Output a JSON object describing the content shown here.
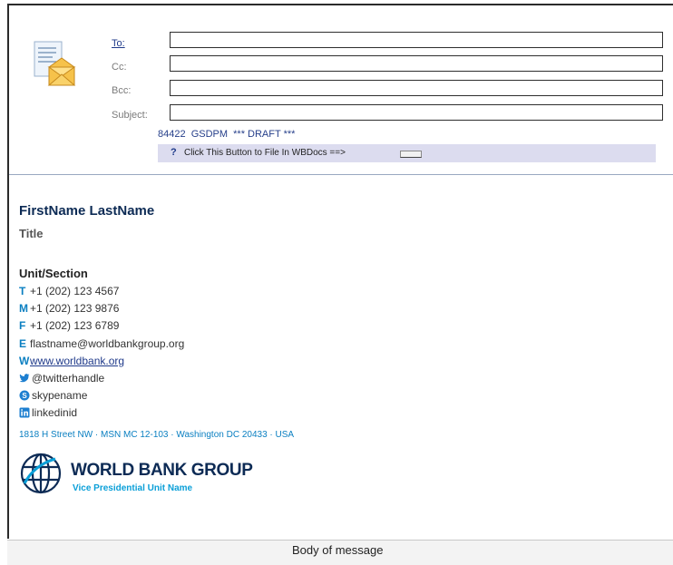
{
  "header": {
    "fields": [
      {
        "label": "To:",
        "value": ""
      },
      {
        "label": "Cc:",
        "value": ""
      },
      {
        "label": "Bcc:",
        "value": ""
      },
      {
        "label": "Subject:",
        "value": ""
      }
    ],
    "tag_line": "84422  GSDPM  *** DRAFT ***",
    "file_button": {
      "icon": "?",
      "text": "Click This Button to File In WBDocs ==>"
    }
  },
  "signature": {
    "name": "FirstName LastName",
    "title": "Title",
    "unit": "Unit/Section",
    "contacts": [
      {
        "key": "T",
        "text": "+1 (202) 123 4567"
      },
      {
        "key": "M",
        "text": "+1 (202) 123 9876"
      },
      {
        "key": "F",
        "text": "+1 (202) 123 6789"
      },
      {
        "key": "E",
        "text": "flastname@worldbankgroup.org"
      },
      {
        "key": "W",
        "text": "www.worldbank.org"
      },
      {
        "icon": "twitter-icon",
        "text": "@twitterhandle"
      },
      {
        "icon": "skype-icon",
        "text": "skypename"
      },
      {
        "icon": "linkedin-icon",
        "text": "linkedinid"
      }
    ],
    "address": "1818 H Street NW · MSN MC 12-103 · Washington DC 20433 · USA",
    "org_name": "WORLD BANK GROUP",
    "org_unit": "Vice Presidential Unit Name"
  },
  "body_label": "Body of message",
  "colors": {
    "accent": "#0a7fc1",
    "brand": "#0d2b55",
    "link": "#1f3a8a",
    "file_bar": "#dcdcef"
  }
}
